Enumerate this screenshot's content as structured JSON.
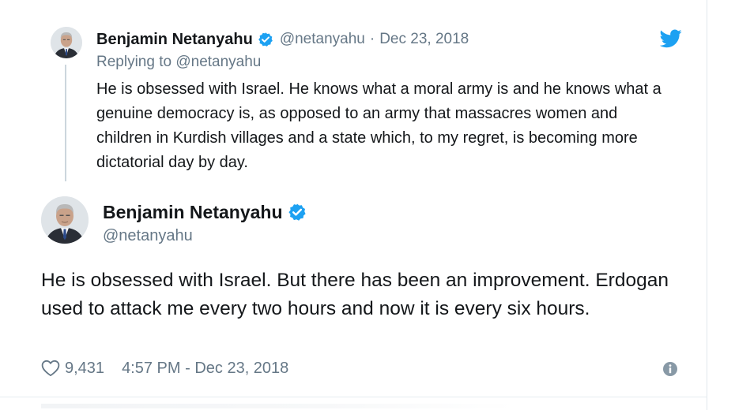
{
  "quoted_tweet": {
    "author_name": "Benjamin Netanyahu",
    "handle": "@netanyahu",
    "separator": "·",
    "date": "Dec 23, 2018",
    "replying_prefix": "Replying to",
    "replying_handle": "@netanyahu",
    "text": "He is obsessed with Israel. He knows what a moral army is and he knows what a genuine democracy is, as opposed to an army that massacres women and children in Kurdish villages and a state which, to my regret, is becoming more dictatorial day by day."
  },
  "main_tweet": {
    "author_name": "Benjamin Netanyahu",
    "handle": "@netanyahu",
    "text": "He is obsessed with Israel. But there has been an improvement. Erdogan used to attack me every two hours and now it is every six hours.",
    "likes": "9,431",
    "timestamp": "4:57 PM - Dec 23, 2018"
  },
  "icons": {
    "verified": "verified-badge-icon",
    "brand": "twitter-bird-icon",
    "like": "heart-outline-icon",
    "info": "info-circle-icon"
  },
  "colors": {
    "verified_blue": "#1da1f2",
    "text_primary": "#14171a",
    "text_secondary": "#657786",
    "thread_line": "#ccd6dd"
  }
}
